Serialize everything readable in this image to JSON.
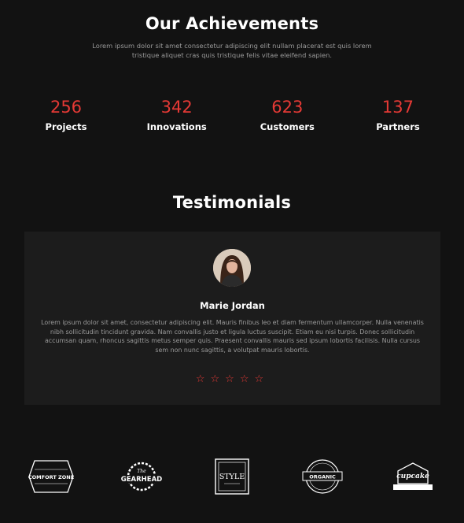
{
  "achievements": {
    "title": "Our Achievements",
    "intro": "Lorem ipsum dolor sit amet consectetur adipiscing elit nullam placerat est quis lorem tristique aliquet cras quis tristique felis vitae eleifend sapien.",
    "stats": [
      {
        "value": "256",
        "label": "Projects"
      },
      {
        "value": "342",
        "label": "Innovations"
      },
      {
        "value": "623",
        "label": "Customers"
      },
      {
        "value": "137",
        "label": "Partners"
      }
    ]
  },
  "testimonials": {
    "title": "Testimonials",
    "name": "Marie Jordan",
    "quote": "Lorem ipsum dolor sit amet, consectetur adipiscing elit. Mauris finibus leo et diam fermentum ullamcorper. Nulla venenatis nibh sollicitudin tincidunt gravida. Nam convallis justo et ligula luctus suscipit. Etiam eu nisi turpis. Donec sollicitudin accumsan quam, rhoncus sagittis metus semper quis. Praesent convallis mauris sed ipsum lobortis facilisis. Nulla cursus sem non nunc sagittis, a volutpat mauris lobortis.",
    "rating": 5,
    "stars": "☆☆☆☆☆"
  },
  "logos": [
    {
      "name": "comfort-zone-logo",
      "text": "COMFORT ZONE"
    },
    {
      "name": "gearhead-logo",
      "text": "GEARHEAD"
    },
    {
      "name": "style-logo",
      "text": "STYLE"
    },
    {
      "name": "organic-logo",
      "text": "ORGANIC"
    },
    {
      "name": "cupcake-logo",
      "text": "cupcake"
    }
  ],
  "colors": {
    "accent": "#e53935",
    "background": "#121212",
    "card": "#1c1c1c",
    "muted": "#9a9a9a"
  }
}
